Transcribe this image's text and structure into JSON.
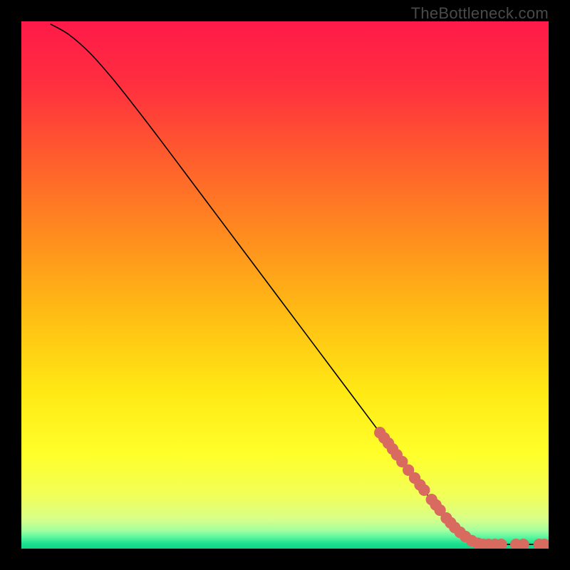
{
  "watermark": "TheBottleneck.com",
  "chart_data": {
    "type": "line",
    "title": "",
    "xlabel": "",
    "ylabel": "",
    "xlim": [
      0,
      100
    ],
    "ylim": [
      0,
      100
    ],
    "grid": false,
    "background_gradient": {
      "stops": [
        {
          "offset": 0.0,
          "color": "#ff1a49"
        },
        {
          "offset": 0.12,
          "color": "#ff2f3f"
        },
        {
          "offset": 0.25,
          "color": "#ff5a2e"
        },
        {
          "offset": 0.4,
          "color": "#ff8a1f"
        },
        {
          "offset": 0.55,
          "color": "#ffbb14"
        },
        {
          "offset": 0.7,
          "color": "#ffe814"
        },
        {
          "offset": 0.82,
          "color": "#ffff2a"
        },
        {
          "offset": 0.9,
          "color": "#f1ff59"
        },
        {
          "offset": 0.945,
          "color": "#d6ff8a"
        },
        {
          "offset": 0.965,
          "color": "#a5ff9f"
        },
        {
          "offset": 0.978,
          "color": "#5cf7a0"
        },
        {
          "offset": 0.99,
          "color": "#1de08f"
        },
        {
          "offset": 1.0,
          "color": "#0fd687"
        }
      ]
    },
    "series": [
      {
        "name": "curve",
        "stroke": "#000000",
        "points": [
          {
            "x": 5.5,
            "y": 99.5
          },
          {
            "x": 9.0,
            "y": 97.5
          },
          {
            "x": 13.0,
            "y": 94.0
          },
          {
            "x": 17.0,
            "y": 89.5
          },
          {
            "x": 21.0,
            "y": 84.5
          },
          {
            "x": 26.0,
            "y": 78.0
          },
          {
            "x": 32.0,
            "y": 70.0
          },
          {
            "x": 38.0,
            "y": 62.0
          },
          {
            "x": 44.0,
            "y": 54.0
          },
          {
            "x": 50.0,
            "y": 46.0
          },
          {
            "x": 56.0,
            "y": 38.0
          },
          {
            "x": 62.0,
            "y": 30.0
          },
          {
            "x": 68.0,
            "y": 22.0
          },
          {
            "x": 74.0,
            "y": 14.0
          },
          {
            "x": 80.0,
            "y": 6.5
          },
          {
            "x": 84.0,
            "y": 2.5
          },
          {
            "x": 86.5,
            "y": 1.2
          },
          {
            "x": 89.0,
            "y": 0.8
          },
          {
            "x": 92.0,
            "y": 0.8
          },
          {
            "x": 95.0,
            "y": 0.8
          },
          {
            "x": 99.5,
            "y": 0.8
          }
        ]
      }
    ],
    "markers": {
      "color": "#d86a5f",
      "radius_data": 1.1,
      "points": [
        {
          "x": 68.0,
          "y": 22.0
        },
        {
          "x": 68.8,
          "y": 21.0
        },
        {
          "x": 69.6,
          "y": 20.0
        },
        {
          "x": 70.4,
          "y": 18.9
        },
        {
          "x": 71.2,
          "y": 17.8
        },
        {
          "x": 72.2,
          "y": 16.5
        },
        {
          "x": 73.4,
          "y": 14.9
        },
        {
          "x": 74.6,
          "y": 13.4
        },
        {
          "x": 75.6,
          "y": 12.1
        },
        {
          "x": 76.4,
          "y": 11.1
        },
        {
          "x": 77.8,
          "y": 9.3
        },
        {
          "x": 78.6,
          "y": 8.3
        },
        {
          "x": 79.4,
          "y": 7.3
        },
        {
          "x": 80.6,
          "y": 5.8
        },
        {
          "x": 81.4,
          "y": 4.9
        },
        {
          "x": 82.2,
          "y": 4.0
        },
        {
          "x": 83.2,
          "y": 3.1
        },
        {
          "x": 84.2,
          "y": 2.3
        },
        {
          "x": 85.4,
          "y": 1.5
        },
        {
          "x": 86.6,
          "y": 1.0
        },
        {
          "x": 87.6,
          "y": 0.8
        },
        {
          "x": 88.6,
          "y": 0.8
        },
        {
          "x": 89.8,
          "y": 0.8
        },
        {
          "x": 91.0,
          "y": 0.8
        },
        {
          "x": 93.8,
          "y": 0.8
        },
        {
          "x": 95.2,
          "y": 0.8
        },
        {
          "x": 98.2,
          "y": 0.8
        },
        {
          "x": 99.2,
          "y": 0.8
        }
      ]
    }
  }
}
